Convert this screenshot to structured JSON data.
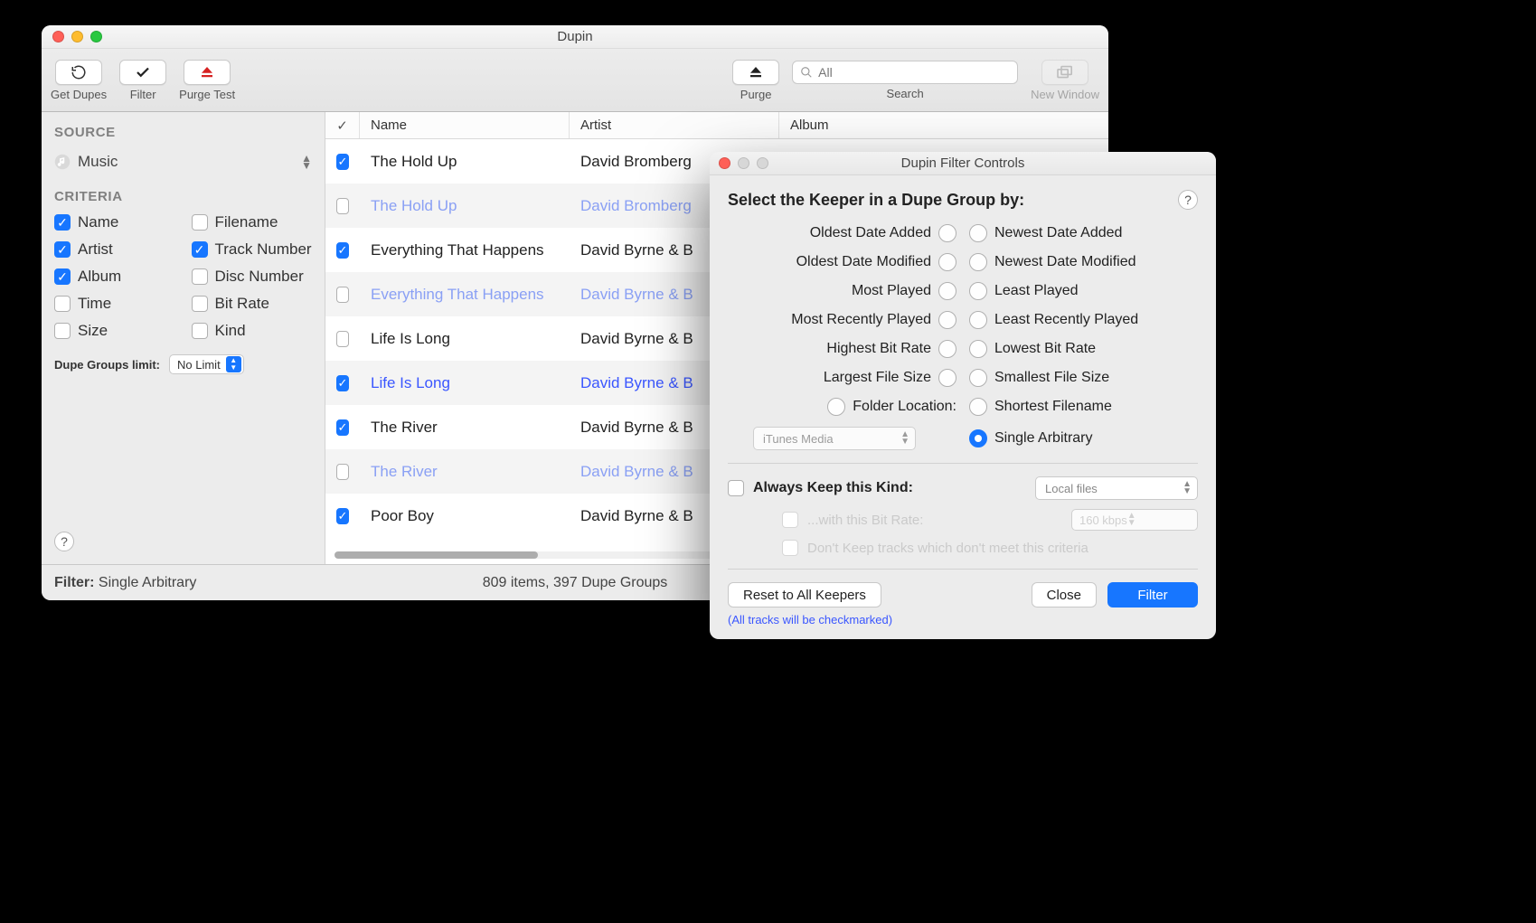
{
  "mainWindow": {
    "title": "Dupin",
    "toolbar": {
      "getDupes": "Get Dupes",
      "filter": "Filter",
      "purgeTest": "Purge Test",
      "purge": "Purge",
      "search": "Search",
      "searchPlaceholder": "All",
      "newWindow": "New Window"
    },
    "sidebar": {
      "sourceHeading": "SOURCE",
      "source": "Music",
      "criteriaHeading": "CRITERIA",
      "criteria": [
        {
          "label": "Name",
          "checked": true
        },
        {
          "label": "Filename",
          "checked": false
        },
        {
          "label": "Artist",
          "checked": true
        },
        {
          "label": "Track Number",
          "checked": true
        },
        {
          "label": "Album",
          "checked": true
        },
        {
          "label": "Disc Number",
          "checked": false
        },
        {
          "label": "Time",
          "checked": false
        },
        {
          "label": "Bit Rate",
          "checked": false
        },
        {
          "label": "Size",
          "checked": false
        },
        {
          "label": "Kind",
          "checked": false
        }
      ],
      "dupeLimitLabel": "Dupe Groups limit:",
      "dupeLimitValue": "No Limit"
    },
    "table": {
      "columns": {
        "check": "✓",
        "name": "Name",
        "artist": "Artist",
        "album": "Album"
      },
      "rows": [
        {
          "checked": true,
          "name": "The Hold Up",
          "artist": "David Bromberg",
          "dup": false
        },
        {
          "checked": false,
          "name": "The Hold Up",
          "artist": "David Bromberg",
          "dup": true,
          "faded": true
        },
        {
          "checked": true,
          "name": "Everything That Happens",
          "artist": "David Byrne & B",
          "dup": false
        },
        {
          "checked": false,
          "name": "Everything That Happens",
          "artist": "David Byrne & B",
          "dup": true,
          "faded": true
        },
        {
          "checked": false,
          "name": "Life Is Long",
          "artist": "David Byrne & B",
          "dup": false
        },
        {
          "checked": true,
          "name": "Life Is Long",
          "artist": "David Byrne & B",
          "dup": true,
          "faded": false
        },
        {
          "checked": true,
          "name": "The River",
          "artist": "David Byrne & B",
          "dup": false
        },
        {
          "checked": false,
          "name": "The River",
          "artist": "David Byrne & B",
          "dup": true,
          "faded": true
        },
        {
          "checked": true,
          "name": "Poor Boy",
          "artist": "David Byrne & B",
          "dup": false
        }
      ]
    },
    "status": {
      "filterLabel": "Filter:",
      "filterValue": "Single Arbitrary",
      "summary": "809 items, 397 Dupe Groups"
    }
  },
  "dialog": {
    "title": "Dupin Filter Controls",
    "heading": "Select the Keeper in a Dupe Group by:",
    "radios": {
      "left": [
        "Oldest Date Added",
        "Oldest Date Modified",
        "Most Played",
        "Most Recently Played",
        "Highest Bit Rate",
        "Largest File Size"
      ],
      "right": [
        "Newest Date Added",
        "Newest Date Modified",
        "Least Played",
        "Least Recently Played",
        "Lowest Bit Rate",
        "Smallest File Size"
      ],
      "folderLabel": "Folder Location:",
      "folderValue": "iTunes Media",
      "shortestFilename": "Shortest Filename",
      "singleArbitrary": "Single Arbitrary",
      "selected": "Single Arbitrary"
    },
    "keepRow": {
      "label": "Always Keep this Kind:",
      "kindValue": "Local files",
      "withBitRateLabel": "...with this Bit Rate:",
      "bitRateValue": "160 kbps",
      "dontKeepLabel": "Don't Keep tracks which don't meet this criteria"
    },
    "buttons": {
      "reset": "Reset to All Keepers",
      "close": "Close",
      "filter": "Filter"
    },
    "note": "(All tracks will be checkmarked)"
  }
}
